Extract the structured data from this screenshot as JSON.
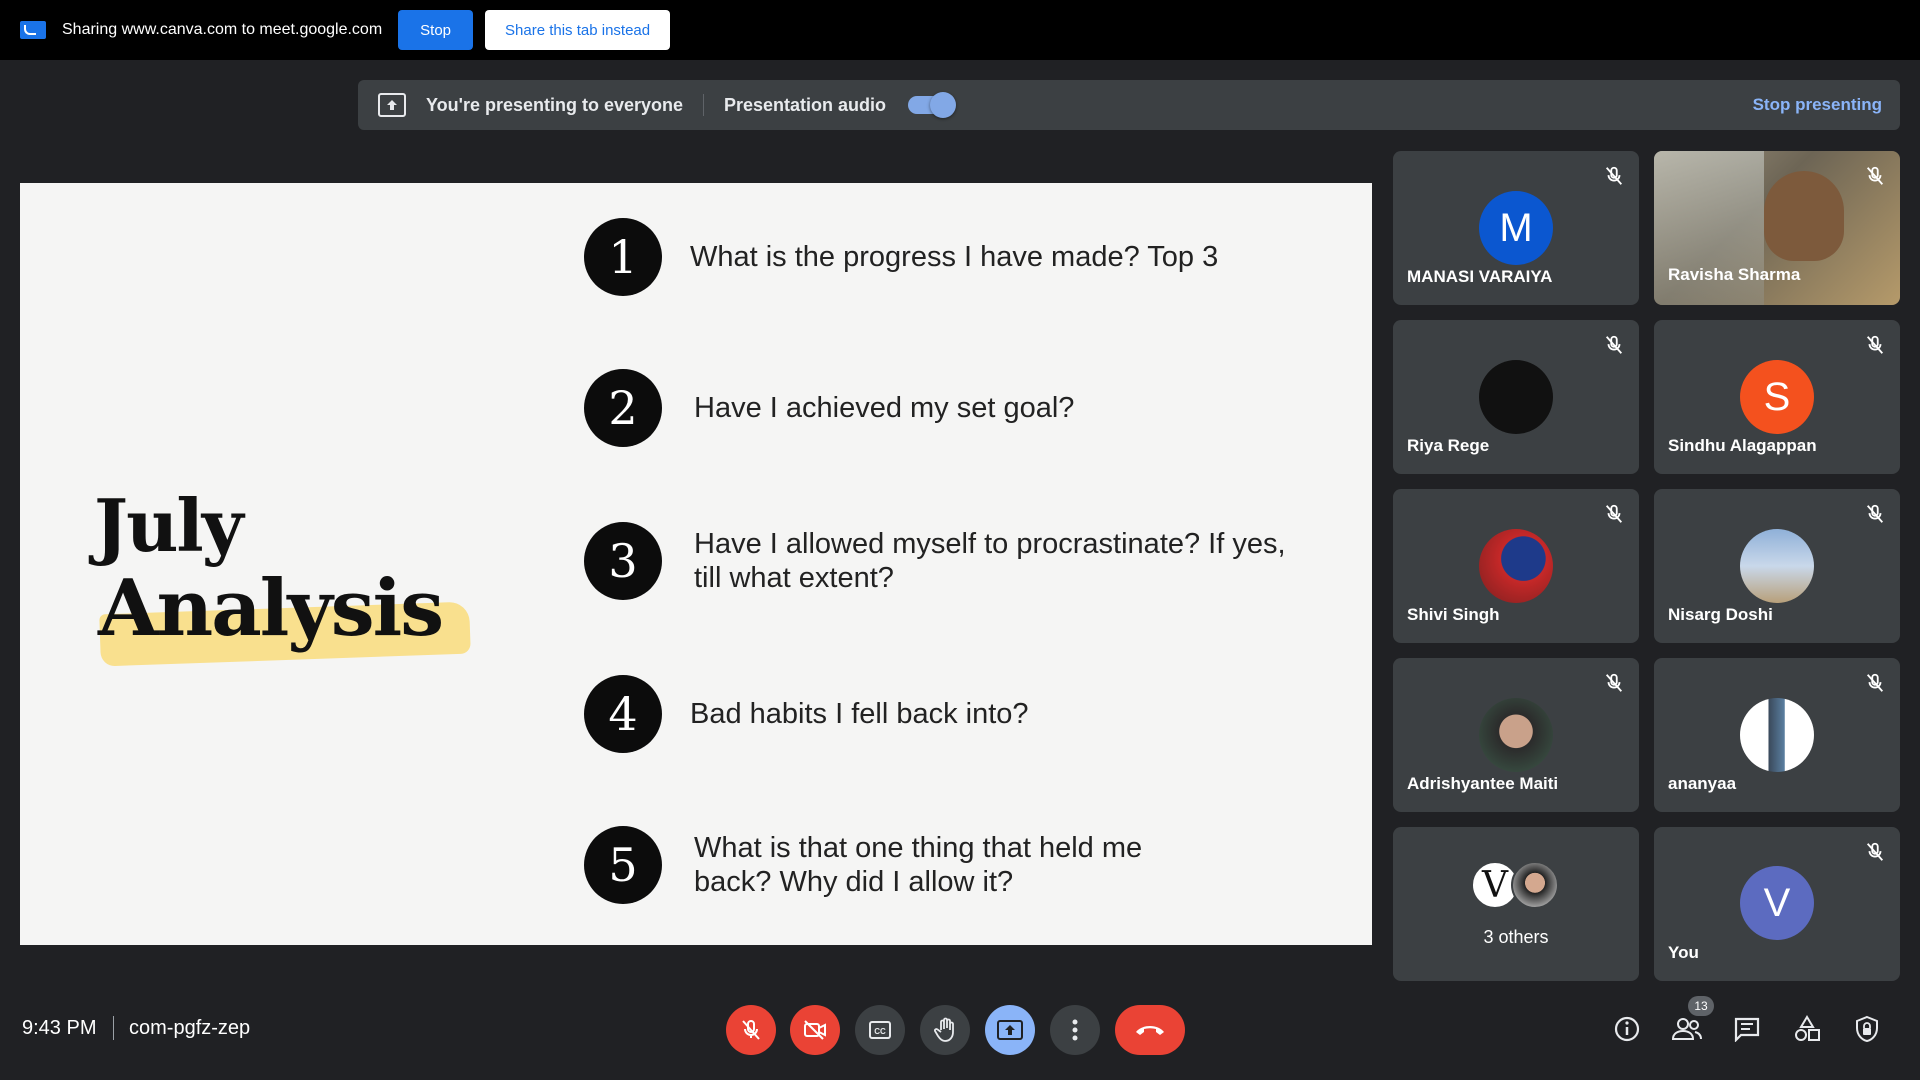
{
  "sharing_bar": {
    "text": "Sharing www.canva.com to meet.google.com",
    "stop_label": "Stop",
    "share_tab_label": "Share this tab instead"
  },
  "presenting_bar": {
    "status": "You're presenting to everyone",
    "audio_label": "Presentation audio",
    "audio_enabled": true,
    "stop_presenting_label": "Stop presenting"
  },
  "slide": {
    "title_line1": "July",
    "title_line2": "Analysis",
    "questions": [
      {
        "num": "1",
        "text": "What is the progress I have made? Top 3"
      },
      {
        "num": "2",
        "text": "Have I achieved my set goal?"
      },
      {
        "num": "3",
        "text": "Have I allowed myself to procrastinate? If yes, till what extent?"
      },
      {
        "num": "4",
        "text": "Bad habits I fell back into?"
      },
      {
        "num": "5",
        "text": "What is that one thing that held me back? Why did I allow it?"
      }
    ]
  },
  "participants": [
    {
      "name": "MANASI VARAIYA",
      "initial": "M",
      "color": "#0b57d0"
    },
    {
      "name": "Ravisha Sharma",
      "initial": "",
      "color": "#7a6a55"
    },
    {
      "name": "Riya Rege",
      "initial": "",
      "color": "#111111"
    },
    {
      "name": "Sindhu Alagappan",
      "initial": "S",
      "color": "#f4511e"
    },
    {
      "name": "Shivi Singh",
      "initial": "",
      "color": "#c62828"
    },
    {
      "name": "Nisarg Doshi",
      "initial": "",
      "color": "#6d8bb5"
    },
    {
      "name": "Adrishyantee Maiti",
      "initial": "",
      "color": "#3d5a4a"
    },
    {
      "name": "ananyaa",
      "initial": "",
      "color": "#ffffff"
    },
    {
      "name": "3 others",
      "initial": "V",
      "color": "#ffffff"
    },
    {
      "name": "You",
      "initial": "V",
      "color": "#5c6bc0"
    }
  ],
  "bottom_bar": {
    "time": "9:43 PM",
    "meeting_code": "com-pgfz-zep",
    "people_count": "13"
  }
}
